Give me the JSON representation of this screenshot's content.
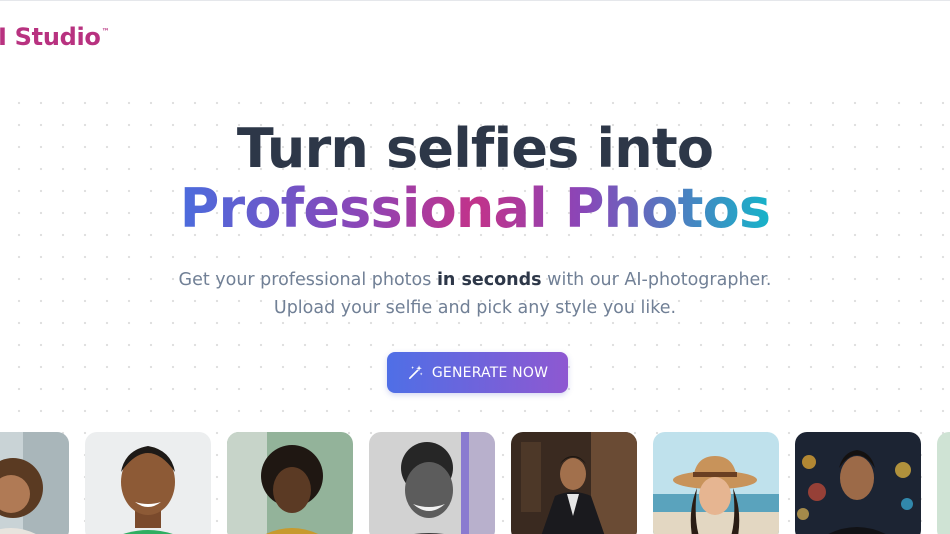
{
  "header": {
    "logo_text": "I Studio",
    "logo_tm": "™"
  },
  "hero": {
    "title_line1": "Turn selfies into",
    "title_line2": "Professional Photos",
    "subtitle_line1_before": "Get your professional photos ",
    "subtitle_line1_bold": "in seconds",
    "subtitle_line1_after": " with our AI-photographer.",
    "subtitle_line2": "Upload your selfie and pick any style you like.",
    "cta_label": "GENERATE NOW"
  },
  "colors": {
    "logo": "#b83280",
    "title": "#2d3748",
    "subtitle": "#718096",
    "cta_start": "#4f6fe6",
    "cta_end": "#8e58d1"
  },
  "gallery": [
    {
      "name": "woman-curly-hair-office"
    },
    {
      "name": "man-smiling-green-shirt"
    },
    {
      "name": "woman-afro-green-background"
    },
    {
      "name": "man-black-and-white-portrait"
    },
    {
      "name": "man-suit-dark-room"
    },
    {
      "name": "woman-straw-hat-beach"
    },
    {
      "name": "man-night-city-lights"
    },
    {
      "name": "partial-portrait"
    }
  ]
}
